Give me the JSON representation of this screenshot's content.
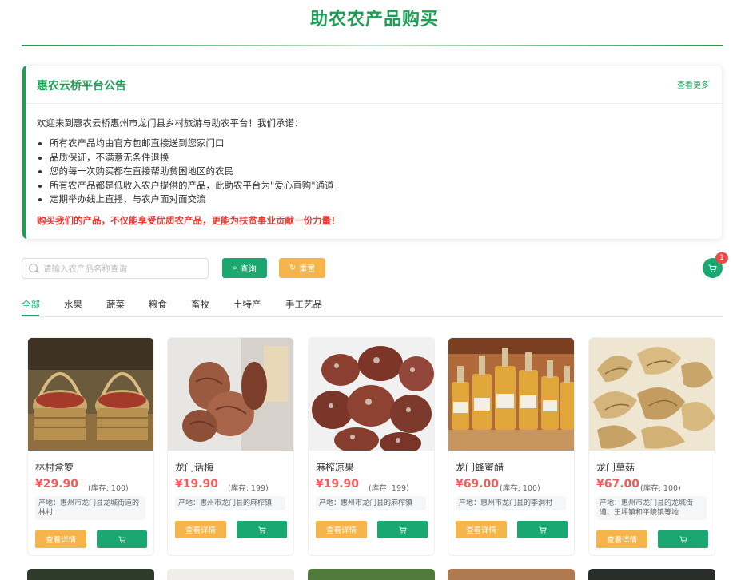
{
  "page": {
    "title": "助农农产品购买"
  },
  "notice": {
    "title": "惠农云桥平台公告",
    "more": "查看更多",
    "intro": "欢迎来到惠农云桥惠州市龙门县乡村旅游与助农平台！我们承诺：",
    "items": [
      "所有农产品均由官方包邮直接送到您家门口",
      "品质保证，不满意无条件退换",
      "您的每一次购买都在直接帮助贫困地区的农民",
      "所有农产品都是低收入农户提供的产品，此助农平台为\"爱心直购\"通道",
      "定期举办线上直播，与农户面对面交流"
    ],
    "emphasis": "购买我们的产品，不仅能享受优质农产品，更能为扶贫事业贡献一份力量！"
  },
  "search": {
    "placeholder": "请输入农产品名称查询",
    "value": "",
    "query_label": "查询",
    "reset_label": "重置"
  },
  "cart": {
    "count": "1"
  },
  "tabs": [
    {
      "label": "全部",
      "active": true
    },
    {
      "label": "水果"
    },
    {
      "label": "蔬菜"
    },
    {
      "label": "粮食"
    },
    {
      "label": "畜牧"
    },
    {
      "label": "土特产"
    },
    {
      "label": "手工艺品"
    }
  ],
  "products": [
    {
      "name": "林村盒箩",
      "price": "¥29.90",
      "stock": "(库存: 100)",
      "origin": "产地：惠州市龙门县龙城街道的林村",
      "detail_label": "查看详情",
      "image": "bamboo-basket"
    },
    {
      "name": "龙门话梅",
      "price": "¥19.90",
      "stock": "(库存: 199)",
      "origin": "产地：惠州市龙门县的麻榨镇",
      "detail_label": "查看详情",
      "image": "dried-plum"
    },
    {
      "name": "麻榨凉果",
      "price": "¥19.90",
      "stock": "(库存: 199)",
      "origin": "产地：惠州市龙门县的麻榨镇",
      "detail_label": "查看详情",
      "image": "candied-fruit"
    },
    {
      "name": "龙门蜂蜜醋",
      "price": "¥69.00",
      "stock": "(库存: 100)",
      "origin": "产地：惠州市龙门县的李洞村",
      "detail_label": "查看详情",
      "image": "honey-vinegar"
    },
    {
      "name": "龙门草菇",
      "price": "¥67.00",
      "stock": "(库存: 100)",
      "origin": "产地：惠州市龙门县的龙城街道、王坪镇和平陵镇等地",
      "detail_label": "查看详情",
      "image": "straw-mushroom"
    }
  ],
  "colors": {
    "brand": "#1e9e55",
    "accent": "#1aa870",
    "warning": "#f6b54a",
    "price": "#f25c5c"
  }
}
